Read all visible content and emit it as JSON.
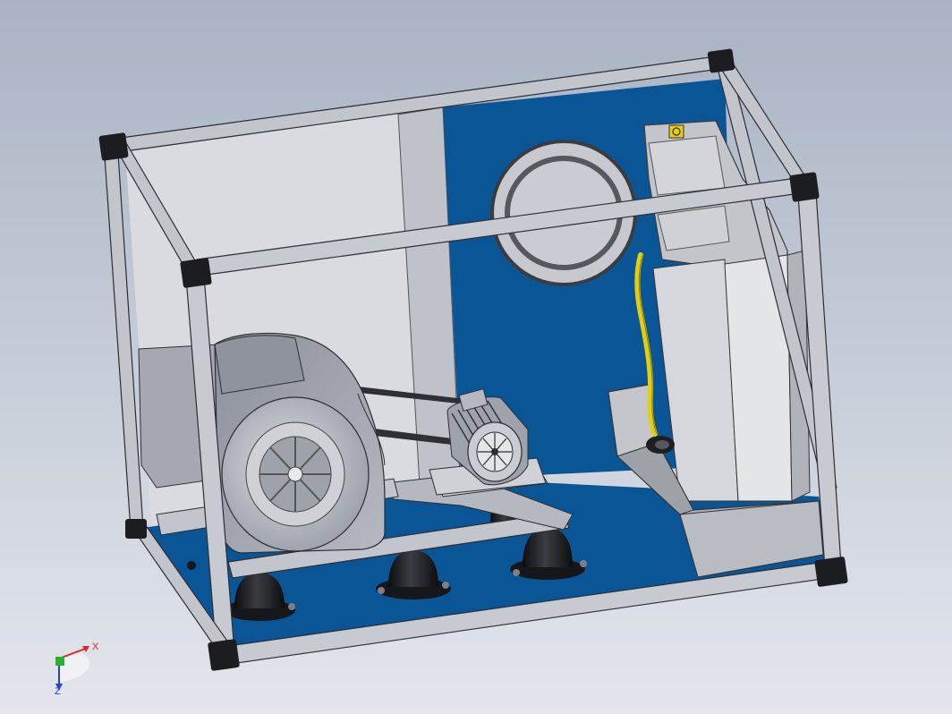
{
  "viewport": {
    "background_top": "#a9b3c3",
    "background_bottom": "#e3e6ec"
  },
  "colors": {
    "panel_blue": "#0a5596",
    "frame_gray": "#c2c5cc",
    "frame_edge": "#2b2e33",
    "corner_black": "#1c1d20",
    "motor_gray": "#b9bcc4",
    "foot_black": "#15171a",
    "hose_yellow": "#e3cf12"
  },
  "triad": {
    "x_label": "X",
    "z_label": "Z",
    "x_color": "#d42a2a",
    "y_color": "#2bb02b",
    "z_color": "#2a3fd4"
  },
  "icons": {
    "fan": "blower-fan-icon",
    "motor": "electric-motor-icon",
    "triad": "coordinate-triad-icon"
  }
}
